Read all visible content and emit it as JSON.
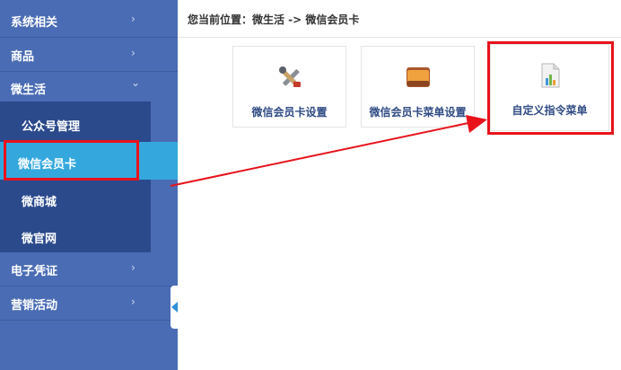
{
  "sidebar": {
    "items": [
      {
        "label": "系统相关",
        "chevron": "›"
      },
      {
        "label": "商品",
        "chevron": "›"
      },
      {
        "label": "微生活",
        "chevron": "⌄"
      },
      {
        "label": "电子凭证",
        "chevron": "›"
      },
      {
        "label": "营销活动",
        "chevron": "›"
      }
    ],
    "submenu": [
      {
        "label": "公众号管理"
      },
      {
        "label": "微信会员卡",
        "active": true
      },
      {
        "label": "微商城"
      },
      {
        "label": "微官网"
      }
    ]
  },
  "breadcrumb": {
    "text": "您当前位置：微生活 -> 微信会员卡"
  },
  "tiles": [
    {
      "label": "微信会员卡设置",
      "icon": "tools-icon"
    },
    {
      "label": "微信会员卡菜单设置",
      "icon": "wallet-icon"
    },
    {
      "label": "自定义指令菜单",
      "icon": "chart-document-icon"
    }
  ],
  "colors": {
    "sidebar": "#4a6cb4",
    "submenu": "#2b4a8c",
    "active": "#34a8dd",
    "highlight": "#e8121b",
    "tile_text": "#2f4b84"
  }
}
